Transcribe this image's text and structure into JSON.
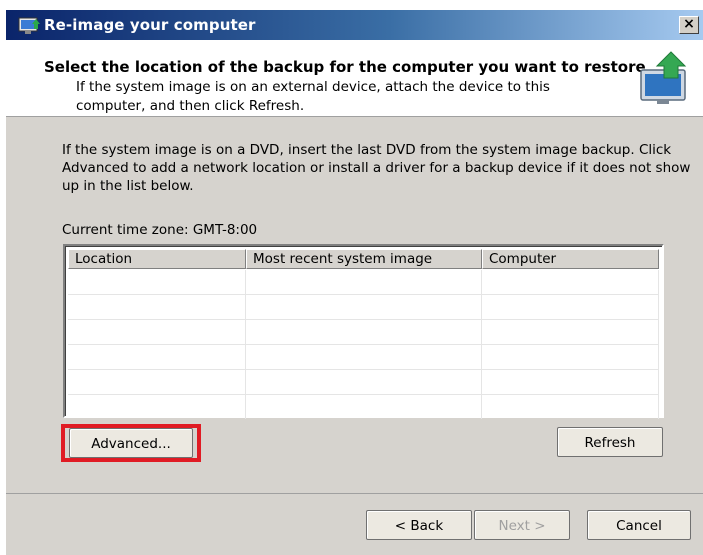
{
  "window": {
    "title": "Re-image your computer",
    "close_glyph": "×"
  },
  "header": {
    "title": "Select the location of the backup for the computer you want to restore",
    "description": "If the system image is on an external device, attach the device to this computer, and then click Refresh.",
    "icon": "restore-computer-icon"
  },
  "body": {
    "instructions": "If the system image is on a DVD, insert the last DVD from the system image backup. Click Advanced to add a network location or install a driver for a backup device if it does not show up in the list below.",
    "timezone": "Current time zone: GMT-8:00"
  },
  "list": {
    "columns": [
      "Location",
      "Most recent system image",
      "Computer"
    ],
    "rows": []
  },
  "buttons": {
    "advanced": "Advanced...",
    "refresh": "Refresh",
    "back": "< Back",
    "next": "Next >",
    "cancel": "Cancel"
  },
  "colors": {
    "highlight": "#e01b24",
    "titlebar_start": "#0a246a",
    "titlebar_end": "#a6caf0"
  }
}
